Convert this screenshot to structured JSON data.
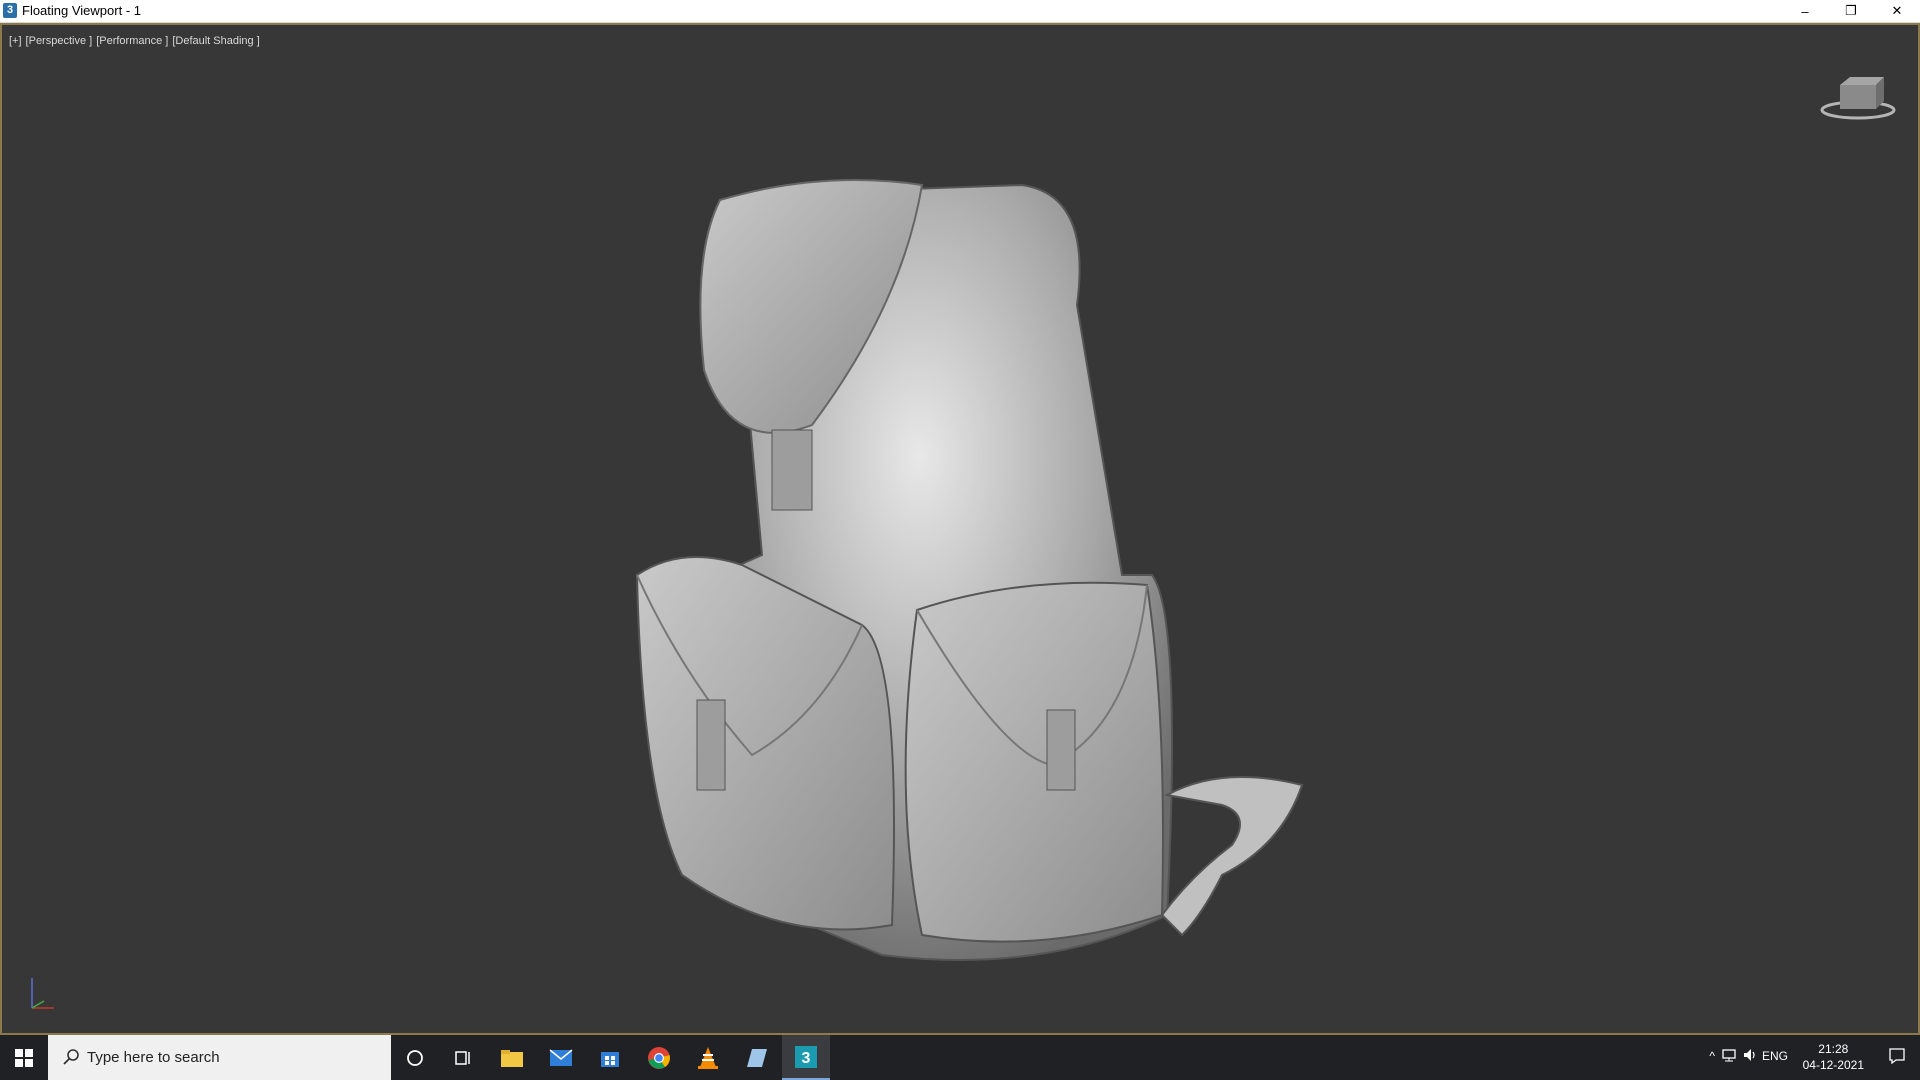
{
  "window": {
    "title": "Floating Viewport - 1",
    "app_icon_glyph": "3",
    "minimize": "–",
    "restore": "❐",
    "close": "✕"
  },
  "viewport": {
    "labels": [
      "[+]",
      "[Perspective ]",
      "[Performance ]",
      "[Default Shading ]"
    ],
    "viewcube_icon": "viewcube-icon",
    "axis_icon": "axis-tripod-icon",
    "model": "backpack-3d-model"
  },
  "taskbar": {
    "search_placeholder": "Type here to search",
    "icons": [
      "windows-start-icon",
      "cortana-icon",
      "task-view-icon",
      "file-explorer-icon",
      "mail-icon",
      "store-icon",
      "chrome-icon",
      "vlc-icon",
      "notes-icon",
      "3dsmax-icon"
    ],
    "tray": {
      "lang": "ENG",
      "time": "21:28",
      "date": "04-12-2021"
    }
  },
  "colors": {
    "viewport_bg": "#373737",
    "viewport_border": "#8d7a4c",
    "taskbar_bg": "#1f2124"
  }
}
